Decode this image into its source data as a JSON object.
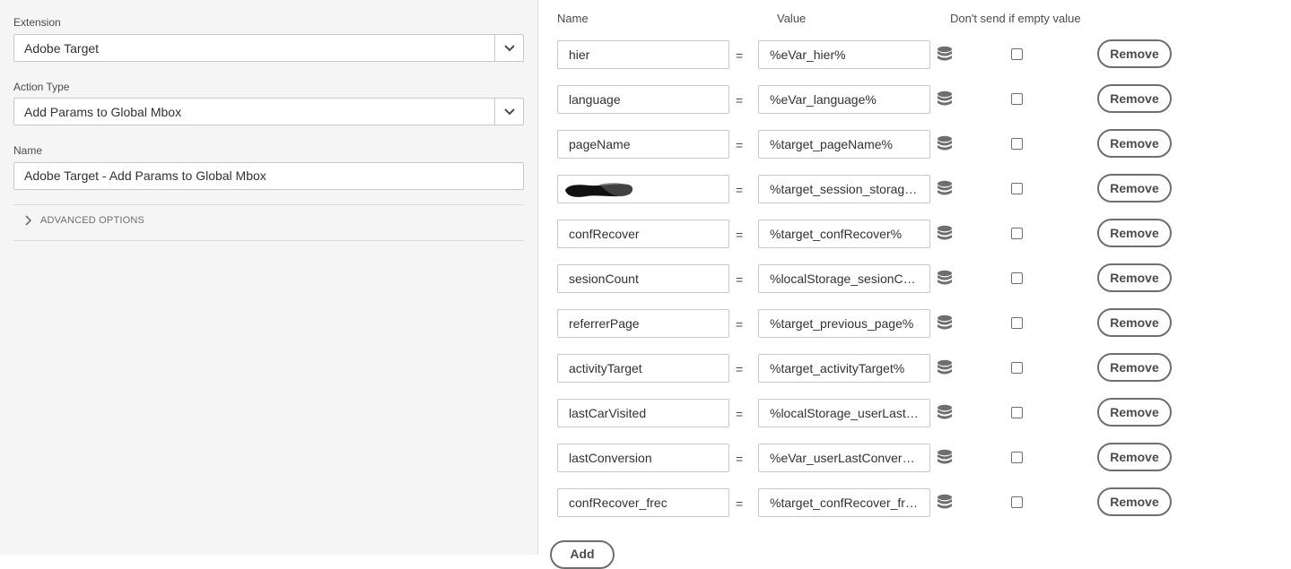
{
  "left_panel": {
    "extension": {
      "label": "Extension",
      "value": "Adobe Target"
    },
    "action_type": {
      "label": "Action Type",
      "value": "Add Params to Global Mbox"
    },
    "name": {
      "label": "Name",
      "value": "Adobe Target - Add Params to Global Mbox"
    },
    "advanced_options": "ADVANCED OPTIONS"
  },
  "params_table": {
    "headers": {
      "name": "Name",
      "value": "Value",
      "dont_send": "Don't send if empty value"
    },
    "equals": "=",
    "remove_label": "Remove",
    "rows": [
      {
        "name": "hier",
        "value": "%eVar_hier%",
        "redacted": false
      },
      {
        "name": "language",
        "value": "%eVar_language%",
        "redacted": false
      },
      {
        "name": "pageName",
        "value": "%target_pageName%",
        "redacted": false
      },
      {
        "name": "",
        "value": "%target_session_storage_...",
        "redacted": true
      },
      {
        "name": "confRecover",
        "value": "%target_confRecover%",
        "redacted": false
      },
      {
        "name": "sesionCount",
        "value": "%localStorage_sesionCoun...",
        "redacted": false
      },
      {
        "name": "referrerPage",
        "value": "%target_previous_page%",
        "redacted": false
      },
      {
        "name": "activityTarget",
        "value": "%target_activityTarget%",
        "redacted": false
      },
      {
        "name": "lastCarVisited",
        "value": "%localStorage_userLastCa...",
        "redacted": false
      },
      {
        "name": "lastConversion",
        "value": "%eVar_userLastConversio...",
        "redacted": false
      },
      {
        "name": "confRecover_frec",
        "value": "%target_confRecover_frec%",
        "redacted": false
      }
    ],
    "add_label": "Add"
  },
  "colors": {
    "left_bg": "#f5f5f5",
    "border": "#c8c8c8",
    "button_border": "#6e6e6e",
    "icon": "#6e6e6e"
  }
}
